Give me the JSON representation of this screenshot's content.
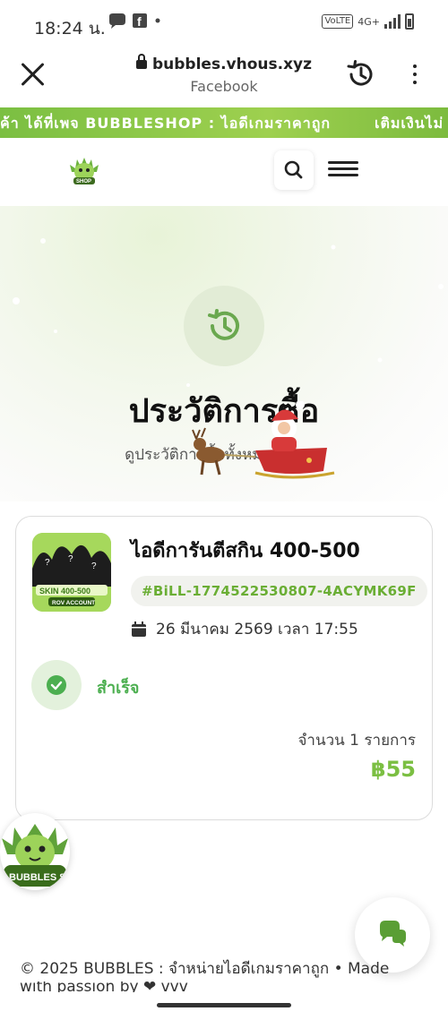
{
  "status_bar": {
    "time": "18:24 น.",
    "icons": "✉ f •",
    "network": "4G+",
    "volte": "VoLTE"
  },
  "browser": {
    "url": "bubbles.vhous.xyz",
    "source": "Facebook"
  },
  "marquee": {
    "text_1": "ค้า ได้ที่เพจ BUBBLESHOP : ไอดีเกมราคาถูก",
    "text_2": "เติมเงินไม่"
  },
  "hero": {
    "title": "ประวัติการซื้อ",
    "subtitle": "ดูประวัติการซื้อทั้งหมดของคุณ"
  },
  "order": {
    "product_name": "ไอดีการันตีสกิน 400-500",
    "bill_id": "#BiLL-1774522530807-4ACYMK69F",
    "date": "26 มีนาคม 2569 เวลา 17:55",
    "status": "สำเร็จ",
    "quantity": "จำนวน 1 รายการ",
    "price": "฿55",
    "thumb_text_1": "SKIN 400-500",
    "thumb_text_2": "ROV ACCOUNT"
  },
  "mascot": {
    "label": "BUBBLES SHOP"
  },
  "footer": {
    "copyright": "© 2025 BUBBLES : จำหน่ายไอดีเกมราคาถูก • Made",
    "line2": "with passion by ❤ vvv"
  },
  "colors": {
    "accent": "#7bbf42",
    "success": "#4caf50"
  }
}
